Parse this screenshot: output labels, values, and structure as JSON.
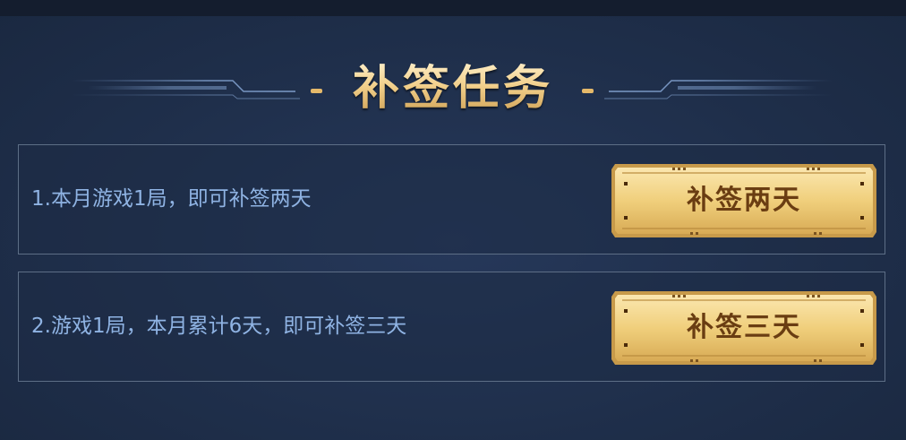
{
  "panel": {
    "title": "补签任务"
  },
  "tasks": [
    {
      "description": "1.本月游戏1局，即可补签两天",
      "button_label": "补签两天"
    },
    {
      "description": "2.游戏1局，本月累计6天，即可补签三天",
      "button_label": "补签三天"
    }
  ],
  "colors": {
    "background": "#1f2e47",
    "task_text": "#8fb3e3",
    "title_gold": "#f2d08b",
    "button_gold": "#f0cf7c",
    "button_text": "#6a3d12",
    "border": "#5d6e86"
  }
}
